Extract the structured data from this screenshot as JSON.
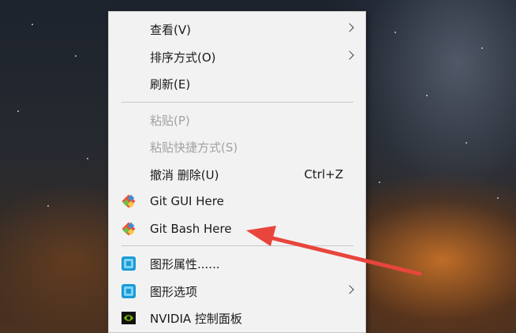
{
  "menu": {
    "items": [
      {
        "label": "查看(V)",
        "submenu": true
      },
      {
        "label": "排序方式(O)",
        "submenu": true
      },
      {
        "label": "刷新(E)"
      },
      {
        "label": "粘贴(P)",
        "disabled": true
      },
      {
        "label": "粘贴快捷方式(S)",
        "disabled": true
      },
      {
        "label": "撤消 删除(U)",
        "shortcut": "Ctrl+Z"
      },
      {
        "label": "Git GUI Here",
        "icon": "git-icon"
      },
      {
        "label": "Git Bash Here",
        "icon": "git-icon"
      },
      {
        "label": "图形属性......",
        "icon": "intel-graphics-icon"
      },
      {
        "label": "图形选项",
        "icon": "intel-graphics-icon",
        "submenu": true
      },
      {
        "label": "NVIDIA 控制面板",
        "icon": "nvidia-icon"
      }
    ]
  },
  "colors": {
    "annotation_arrow": "#e8453c",
    "menu_background": "#f2f2f2",
    "disabled_text": "#a2a2a2"
  }
}
